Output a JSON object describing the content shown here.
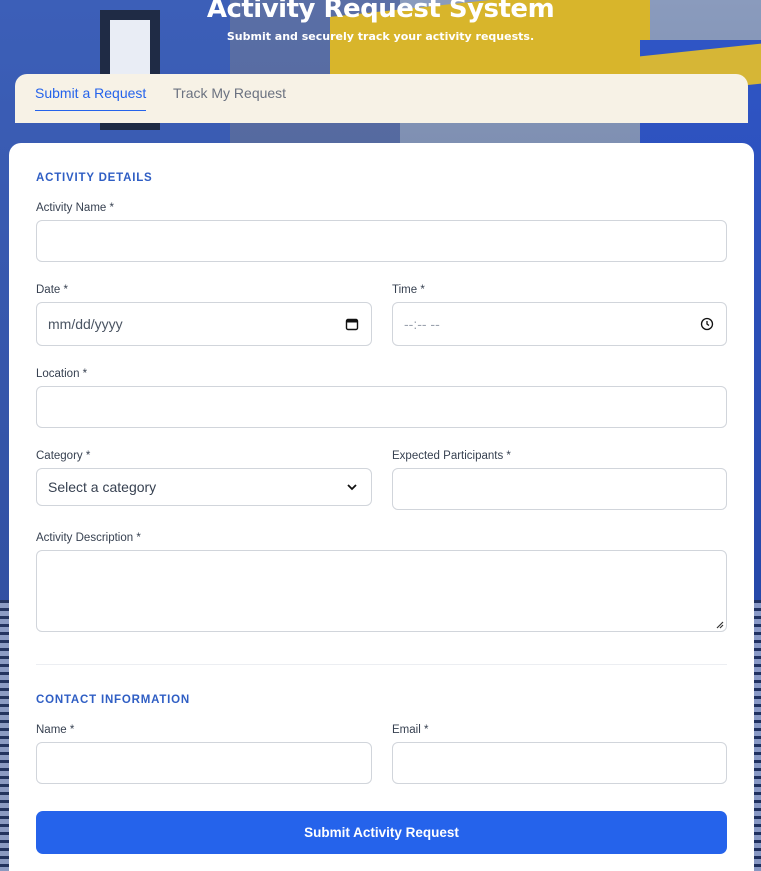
{
  "header": {
    "title": "Activity Request System",
    "subtitle": "Submit and securely track your activity requests."
  },
  "tabs": [
    {
      "label": "Submit a Request",
      "active": true
    },
    {
      "label": "Track My Request",
      "active": false
    }
  ],
  "sections": {
    "activity": "ACTIVITY DETAILS",
    "contact": "CONTACT INFORMATION"
  },
  "fields": {
    "activity_name": {
      "label": "Activity Name *",
      "value": ""
    },
    "date": {
      "label": "Date *",
      "value": "mm/dd/yyyy"
    },
    "time": {
      "label": "Time *",
      "value": "--:-- --"
    },
    "location": {
      "label": "Location *",
      "value": ""
    },
    "category": {
      "label": "Category *",
      "value": "Select a category"
    },
    "participants": {
      "label": "Expected Participants *",
      "value": ""
    },
    "description": {
      "label": "Activity Description *",
      "value": ""
    },
    "name": {
      "label": "Name *",
      "value": ""
    },
    "email": {
      "label": "Email *",
      "value": ""
    }
  },
  "submit_label": "Submit Activity Request",
  "colors": {
    "accent": "#2563eb",
    "section": "#2f5ec4"
  },
  "icons": {
    "date": "calendar-icon",
    "time": "clock-icon",
    "category": "chevron-down-icon"
  }
}
